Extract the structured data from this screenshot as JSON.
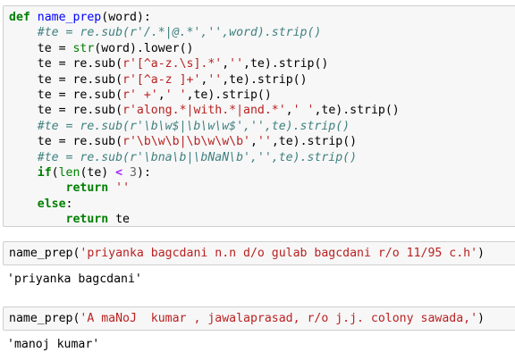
{
  "cells": [
    {
      "type": "code",
      "lines": [
        [
          {
            "t": "def",
            "c": "k"
          },
          {
            "t": " "
          },
          {
            "t": "name_prep",
            "c": "fn"
          },
          {
            "t": "(word):"
          }
        ],
        [
          {
            "t": "    "
          },
          {
            "t": "#te = re.sub(r'/.*|@.*','',word).strip()",
            "c": "c"
          }
        ],
        [
          {
            "t": "    te = "
          },
          {
            "t": "str",
            "c": "bi"
          },
          {
            "t": "(word).lower()"
          }
        ],
        [
          {
            "t": "    te = re.sub("
          },
          {
            "t": "r'[^a-z.\\s].*'",
            "c": "s"
          },
          {
            "t": ","
          },
          {
            "t": "''",
            "c": "s"
          },
          {
            "t": ",te).strip()"
          }
        ],
        [
          {
            "t": "    te = re.sub("
          },
          {
            "t": "r'[^a-z ]+'",
            "c": "s"
          },
          {
            "t": ","
          },
          {
            "t": "''",
            "c": "s"
          },
          {
            "t": ",te).strip()"
          }
        ],
        [
          {
            "t": "    te = re.sub("
          },
          {
            "t": "r' +'",
            "c": "s"
          },
          {
            "t": ","
          },
          {
            "t": "' '",
            "c": "s"
          },
          {
            "t": ",te).strip()"
          }
        ],
        [
          {
            "t": "    te = re.sub("
          },
          {
            "t": "r'along.*|with.*|and.*'",
            "c": "s"
          },
          {
            "t": ","
          },
          {
            "t": "' '",
            "c": "s"
          },
          {
            "t": ",te).strip()"
          }
        ],
        [
          {
            "t": "    "
          },
          {
            "t": "#te = re.sub(r'\\b\\w$|\\b\\w\\w$','',te).strip()",
            "c": "c"
          }
        ],
        [
          {
            "t": "    te = re.sub("
          },
          {
            "t": "r'\\b\\w\\b|\\b\\w\\w\\b'",
            "c": "s"
          },
          {
            "t": ","
          },
          {
            "t": "''",
            "c": "s"
          },
          {
            "t": ",te).strip()"
          }
        ],
        [
          {
            "t": "    "
          },
          {
            "t": "#te = re.sub(r'\\bna\\b|\\bNaN\\b','',te).strip()",
            "c": "c"
          }
        ],
        [
          {
            "t": "    "
          },
          {
            "t": "if",
            "c": "k"
          },
          {
            "t": "("
          },
          {
            "t": "len",
            "c": "bi"
          },
          {
            "t": "(te) "
          },
          {
            "t": "<",
            "c": "o"
          },
          {
            "t": " "
          },
          {
            "t": "3",
            "c": "m"
          },
          {
            "t": "):"
          }
        ],
        [
          {
            "t": "        "
          },
          {
            "t": "return",
            "c": "k"
          },
          {
            "t": " "
          },
          {
            "t": "''",
            "c": "s"
          }
        ],
        [
          {
            "t": "    "
          },
          {
            "t": "else",
            "c": "k"
          },
          {
            "t": ":"
          }
        ],
        [
          {
            "t": "        "
          },
          {
            "t": "return",
            "c": "k"
          },
          {
            "t": " te"
          }
        ]
      ]
    },
    {
      "type": "code",
      "lines": [
        [
          {
            "t": "name_prep("
          },
          {
            "t": "'priyanka bagcdani n.n d/o gulab bagcdani r/o 11/95 c.h'",
            "c": "s"
          },
          {
            "t": ")"
          }
        ]
      ],
      "output": "'priyanka bagcdani'"
    },
    {
      "type": "code",
      "lines": [
        [
          {
            "t": "name_prep("
          },
          {
            "t": "'A maNoJ  kumar , jawalaprasad, r/o j.j. colony sawada,'",
            "c": "s"
          },
          {
            "t": ")"
          }
        ]
      ],
      "output": "'manoj kumar'"
    }
  ]
}
